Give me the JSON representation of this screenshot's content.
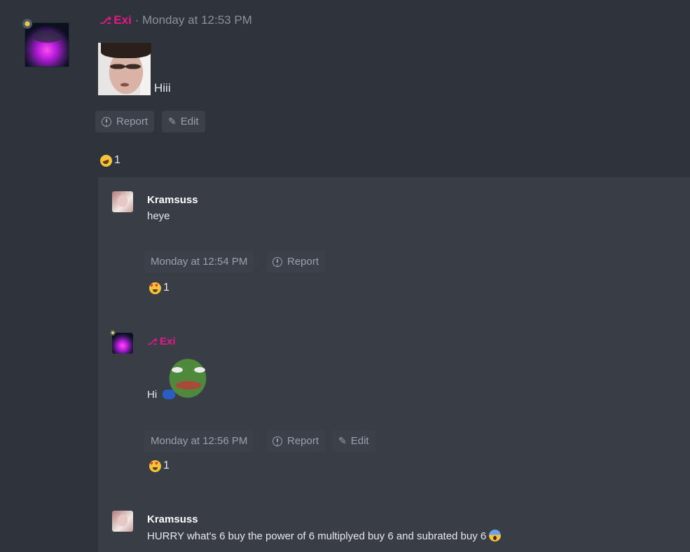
{
  "post": {
    "author": "Exi",
    "separator": "·",
    "timestamp": "Monday at 12:53 PM",
    "message": "Hiii",
    "actions": {
      "report": "Report",
      "edit": "Edit"
    },
    "reaction": {
      "emoji": "rofl-emoji",
      "count": "1"
    }
  },
  "replies": [
    {
      "author": "Kramsuss",
      "text": "heye",
      "timestamp": "Monday at 12:54 PM",
      "actions": {
        "report": "Report"
      },
      "reaction": {
        "emoji": "heart-eyes-emoji",
        "count": "1"
      }
    },
    {
      "author": "Exi",
      "text": "Hi",
      "timestamp": "Monday at 12:56 PM",
      "actions": {
        "report": "Report",
        "edit": "Edit"
      },
      "reaction": {
        "emoji": "heart-eyes-emoji",
        "count": "1"
      }
    },
    {
      "author": "Kramsuss",
      "text": "HURRY what's 6 buy the power of 6 multiplyed buy 6 and subrated buy 6"
    }
  ],
  "colors": {
    "background": "#2f333b",
    "thread_background": "#393e46",
    "role_accent": "#e6178a",
    "button_background": "#3b4049",
    "muted_text": "#8b9199"
  }
}
